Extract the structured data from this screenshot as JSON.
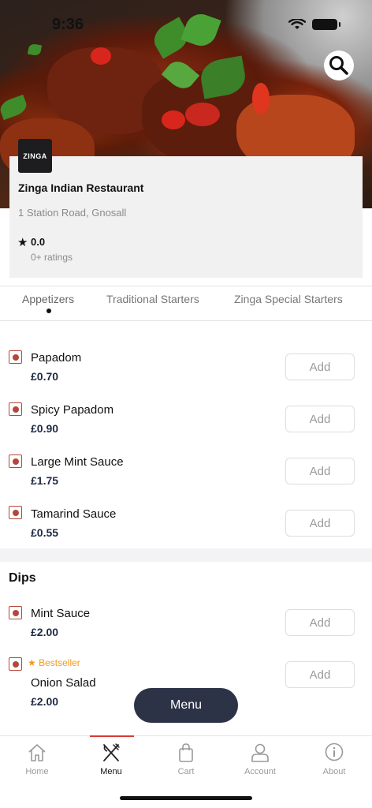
{
  "status_bar": {
    "time": "9:36"
  },
  "restaurant": {
    "logo_text": "ZINGA",
    "name": "Zinga Indian Restaurant",
    "address": "1 Station Road, Gnosall",
    "rating": "0.0",
    "ratings_count": "0+ ratings"
  },
  "tabs": [
    {
      "label": "Appetizers",
      "active": true
    },
    {
      "label": "Traditional Starters",
      "active": false
    },
    {
      "label": "Zinga Special Starters",
      "active": false
    }
  ],
  "appetizers": [
    {
      "name": "Papadom",
      "price": "£0.70",
      "add_label": "Add"
    },
    {
      "name": "Spicy Papadom",
      "price": "£0.90",
      "add_label": "Add"
    },
    {
      "name": "Large Mint Sauce",
      "price": "£1.75",
      "add_label": "Add"
    },
    {
      "name": "Tamarind Sauce",
      "price": "£0.55",
      "add_label": "Add"
    }
  ],
  "dips": {
    "title": "Dips",
    "items": [
      {
        "name": "Mint Sauce",
        "price": "£2.00",
        "add_label": "Add"
      },
      {
        "name": "Onion Salad",
        "price": "£2.00",
        "add_label": "Add",
        "badge": "Bestseller"
      }
    ]
  },
  "floating_menu_label": "Menu",
  "bottom_nav": [
    {
      "label": "Home",
      "icon": "home-icon"
    },
    {
      "label": "Menu",
      "icon": "fork-knife-icon",
      "active": true
    },
    {
      "label": "Cart",
      "icon": "shopping-bag-icon"
    },
    {
      "label": "Account",
      "icon": "user-icon"
    },
    {
      "label": "About",
      "icon": "info-icon"
    }
  ],
  "colors": {
    "accent": "#d53a3a",
    "veg_mark": "#b5473a",
    "bestseller": "#f29a18",
    "floating_menu_bg": "#2d3347",
    "price": "#1e2a44"
  }
}
